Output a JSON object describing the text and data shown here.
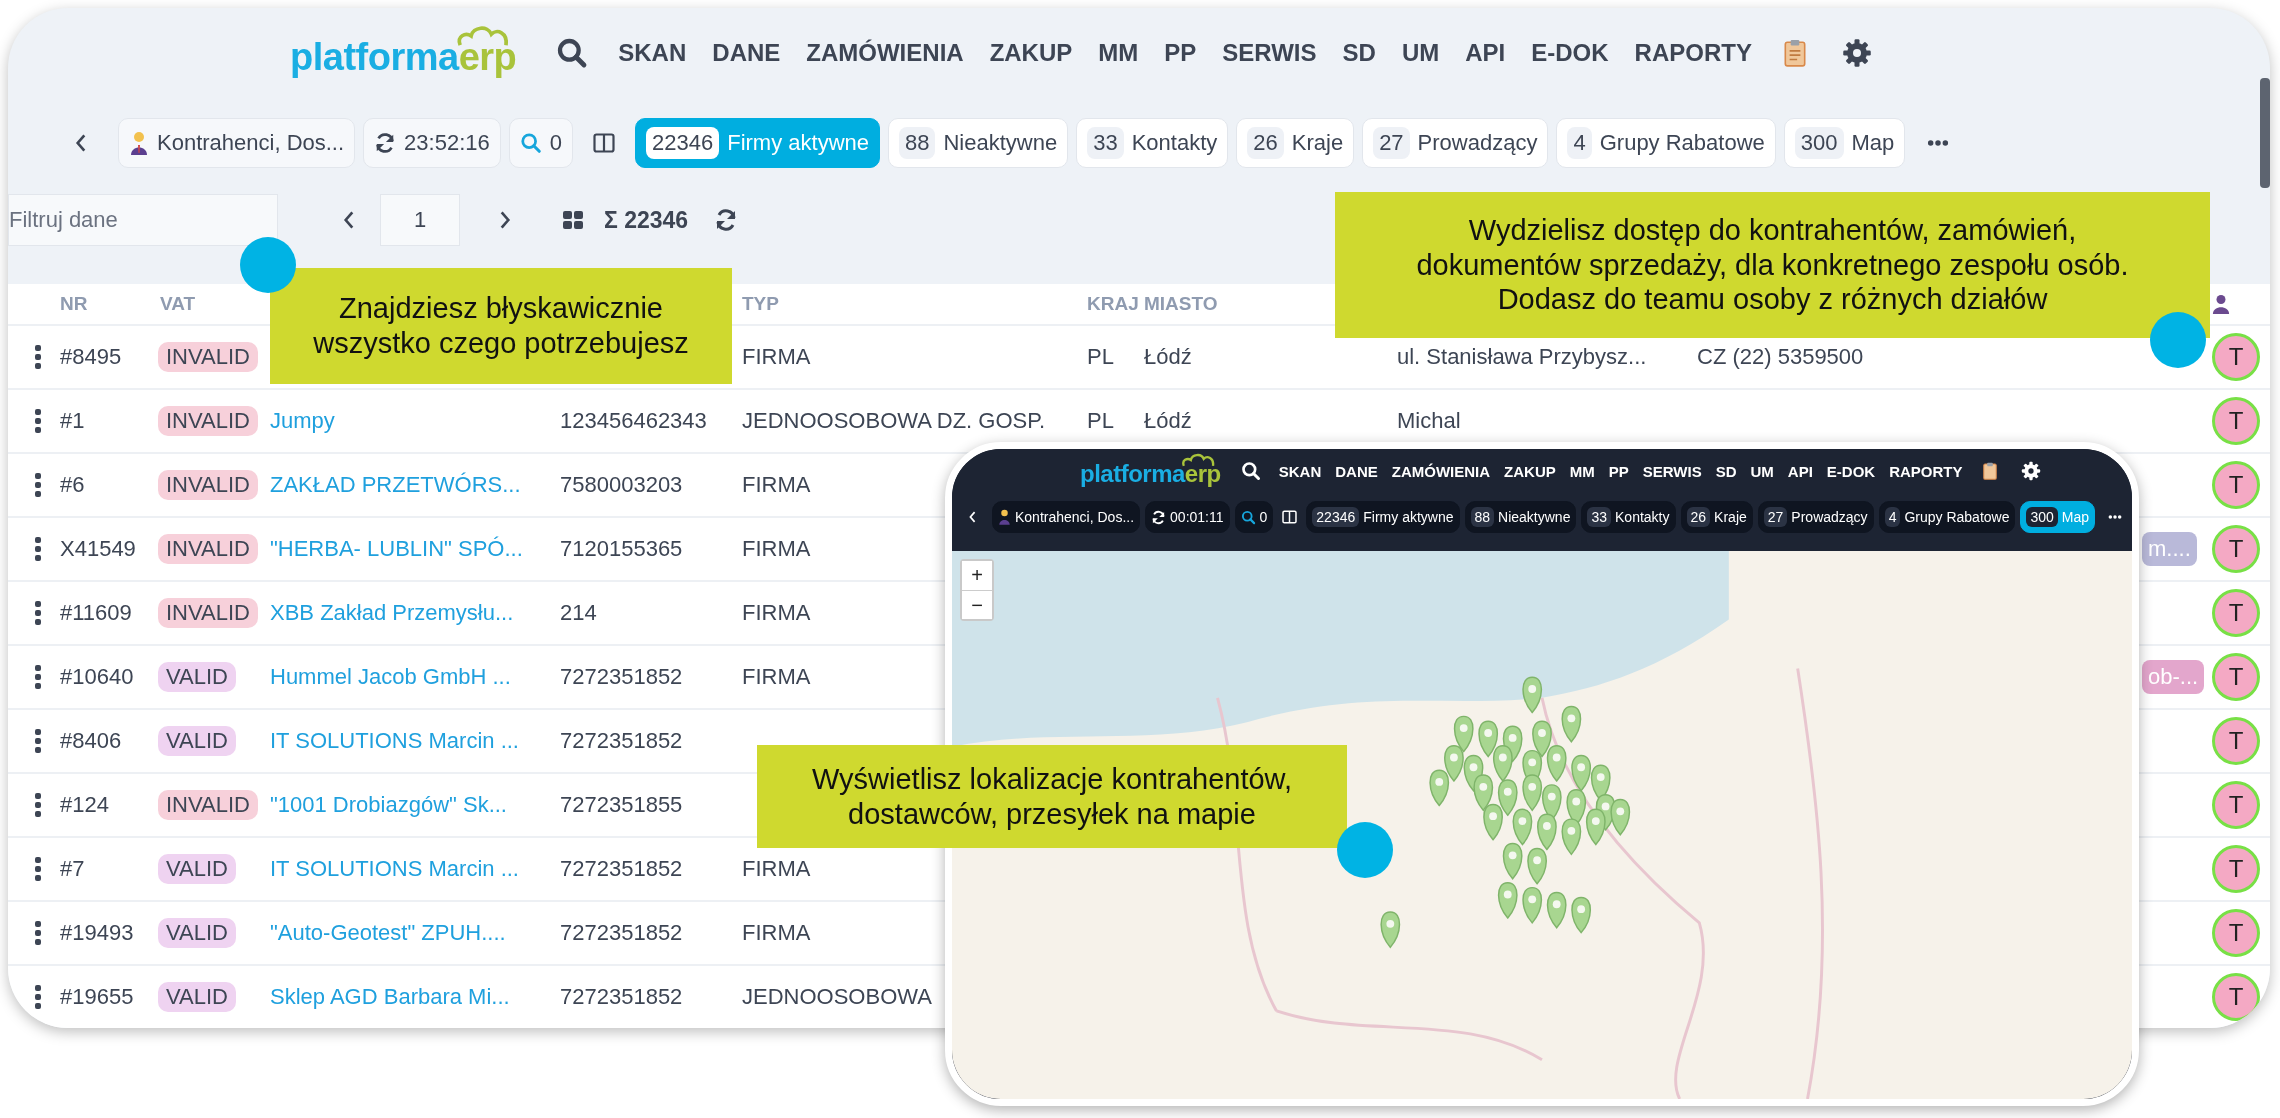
{
  "nav": {
    "logo": [
      "platforma",
      "erp"
    ],
    "items": [
      "SKAN",
      "DANE",
      "ZAMÓWIENIA",
      "ZAKUP",
      "MM",
      "PP",
      "SERWIS",
      "SD",
      "UM",
      "API",
      "E-DOK",
      "RAPORTY"
    ]
  },
  "toolbar": {
    "view": "Kontrahenci, Dos...",
    "time": "23:52:16",
    "search_count": "0",
    "tabs": [
      {
        "count": "22346",
        "label": "Firmy aktywne",
        "selected": true
      },
      {
        "count": "88",
        "label": "Nieaktywne",
        "selected": false
      },
      {
        "count": "33",
        "label": "Kontakty",
        "selected": false
      },
      {
        "count": "26",
        "label": "Kraje",
        "selected": false
      },
      {
        "count": "27",
        "label": "Prowadzący",
        "selected": false
      },
      {
        "count": "4",
        "label": "Grupy Rabatowe",
        "selected": false
      },
      {
        "count": "300",
        "label": "Map",
        "selected": false
      }
    ]
  },
  "filter": {
    "placeholder": "Filtruj dane",
    "page": "1",
    "total": "Σ 22346"
  },
  "table": {
    "columns": [
      "NR",
      "VAT",
      "TYP",
      "KRAJ",
      "MIASTO"
    ],
    "rows": [
      {
        "nr": "#8495",
        "vat": {
          "label": "INVALID",
          "valid": false
        },
        "typ": "FIRMA",
        "kraj": "PL",
        "miasto": "Łódź",
        "ulica": "ul. Stanisława Przybysz...",
        "tel": "CZ (22) 5359500",
        "avatar": "T"
      },
      {
        "nr": "#1",
        "vat": {
          "label": "INVALID",
          "valid": false
        },
        "firma": "Jumpy",
        "nip": "123456462343",
        "typ": "JEDNOOSOBOWA DZ. GOSP.",
        "kraj": "PL",
        "miasto": "Łódź",
        "ulica": "Michal",
        "avatar": "T"
      },
      {
        "nr": "#6",
        "vat": {
          "label": "INVALID",
          "valid": false
        },
        "firma": "ZAKŁAD PRZETWÓRS...",
        "nip": "7580003203",
        "typ": "FIRMA",
        "avatar": "T"
      },
      {
        "nr": "X41549",
        "vat": {
          "label": "INVALID",
          "valid": false
        },
        "firma": "\"HERBA- LUBLIN\" SPÓ...",
        "nip": "7120155365",
        "typ": "FIRMA",
        "tag": {
          "text": "m....",
          "color": "#b9b9d9"
        },
        "avatar": "T"
      },
      {
        "nr": "#11609",
        "vat": {
          "label": "INVALID",
          "valid": false
        },
        "firma": "XBB Zakład Przemysłu...",
        "nip": "214",
        "typ": "FIRMA",
        "avatar": "T"
      },
      {
        "nr": "#10640",
        "vat": {
          "label": "VALID",
          "valid": true
        },
        "firma": "Hummel Jacob GmbH ...",
        "nip": "7272351852",
        "typ": "FIRMA",
        "tag": {
          "text": "ob-...",
          "color": "#e3a6cc"
        },
        "avatar": "T"
      },
      {
        "nr": "#8406",
        "vat": {
          "label": "VALID",
          "valid": true
        },
        "firma": "IT SOLUTIONS Marcin ...",
        "nip": "7272351852",
        "avatar": "T"
      },
      {
        "nr": "#124",
        "vat": {
          "label": "INVALID",
          "valid": false
        },
        "firma": "\"1001 Drobiazgów\" Sk...",
        "nip": "7272351855",
        "avatar": "T"
      },
      {
        "nr": "#7",
        "vat": {
          "label": "VALID",
          "valid": true
        },
        "firma": "IT SOLUTIONS Marcin ...",
        "nip": "7272351852",
        "typ": "FIRMA",
        "avatar": "T"
      },
      {
        "nr": "#19493",
        "vat": {
          "label": "VALID",
          "valid": true
        },
        "firma": "\"Auto-Geotest\" ZPUH....",
        "nip": "7272351852",
        "typ": "FIRMA",
        "avatar": "T"
      },
      {
        "nr": "#19655",
        "vat": {
          "label": "VALID",
          "valid": true
        },
        "firma": "Sklep AGD Barbara Mi...",
        "nip": "7272351852",
        "typ": "JEDNOOSOBOWA",
        "avatar": "T"
      }
    ]
  },
  "map_window": {
    "nav": {
      "logo": [
        "platforma",
        "erp"
      ],
      "items": [
        "SKAN",
        "DANE",
        "ZAMÓWIENIA",
        "ZAKUP",
        "MM",
        "PP",
        "SERWIS",
        "SD",
        "UM",
        "API",
        "E-DOK",
        "RAPORTY"
      ]
    },
    "toolbar": {
      "view": "Kontrahenci, Dos...",
      "time": "00:01:11",
      "search_count": "0",
      "tabs": [
        {
          "count": "22346",
          "label": "Firmy aktywne",
          "selected": false
        },
        {
          "count": "88",
          "label": "Nieaktywne",
          "selected": false
        },
        {
          "count": "33",
          "label": "Kontakty",
          "selected": false
        },
        {
          "count": "26",
          "label": "Kraje",
          "selected": false
        },
        {
          "count": "27",
          "label": "Prowadzący",
          "selected": false
        },
        {
          "count": "4",
          "label": "Grupy Rabatowe",
          "selected": false
        },
        {
          "count": "300",
          "label": "Map",
          "selected": true
        }
      ]
    },
    "zoom": [
      "+",
      "−"
    ]
  },
  "callouts": [
    {
      "kind": "search",
      "text": "Znajdziesz  błyskawicznie\nwszystko czego potrzebujesz"
    },
    {
      "kind": "team",
      "text": "Wydzielisz dostęp do kontrahentów, zamówień,\ndokumentów sprzedaży, dla konkretnego zespołu osób.\nDodasz do teamu osoby z różnych działów"
    },
    {
      "kind": "map",
      "text": "Wyświetlisz lokalizacje kontrahentów,\ndostawców, przesyłek na mapie"
    }
  ]
}
